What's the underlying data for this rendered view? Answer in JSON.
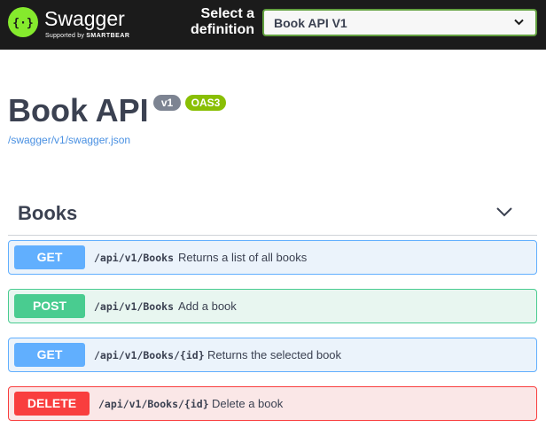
{
  "topbar": {
    "logo_text": "Swagger",
    "logo_sub_prefix": "Supported by",
    "logo_sub_brand": "SMARTBEAR",
    "select_label_line1": "Select a",
    "select_label_line2": "definition",
    "selected_definition": "Book API V1",
    "accent_color": "#85ea2d"
  },
  "info": {
    "title": "Book API",
    "version_badge": "v1",
    "oas_badge": "OAS3",
    "spec_url": "/swagger/v1/swagger.json"
  },
  "tag": {
    "name": "Books",
    "toggle_icon": "chevron-down-icon"
  },
  "operations": [
    {
      "method": "GET",
      "path": "/api/v1/Books",
      "summary": "Returns a list of all books",
      "color": "#61affe"
    },
    {
      "method": "POST",
      "path": "/api/v1/Books",
      "summary": "Add a book",
      "color": "#49cc90"
    },
    {
      "method": "GET",
      "path": "/api/v1/Books/{id}",
      "summary": "Returns the selected book",
      "color": "#61affe"
    },
    {
      "method": "DELETE",
      "path": "/api/v1/Books/{id}",
      "summary": "Delete a book",
      "color": "#f93e3e"
    }
  ]
}
